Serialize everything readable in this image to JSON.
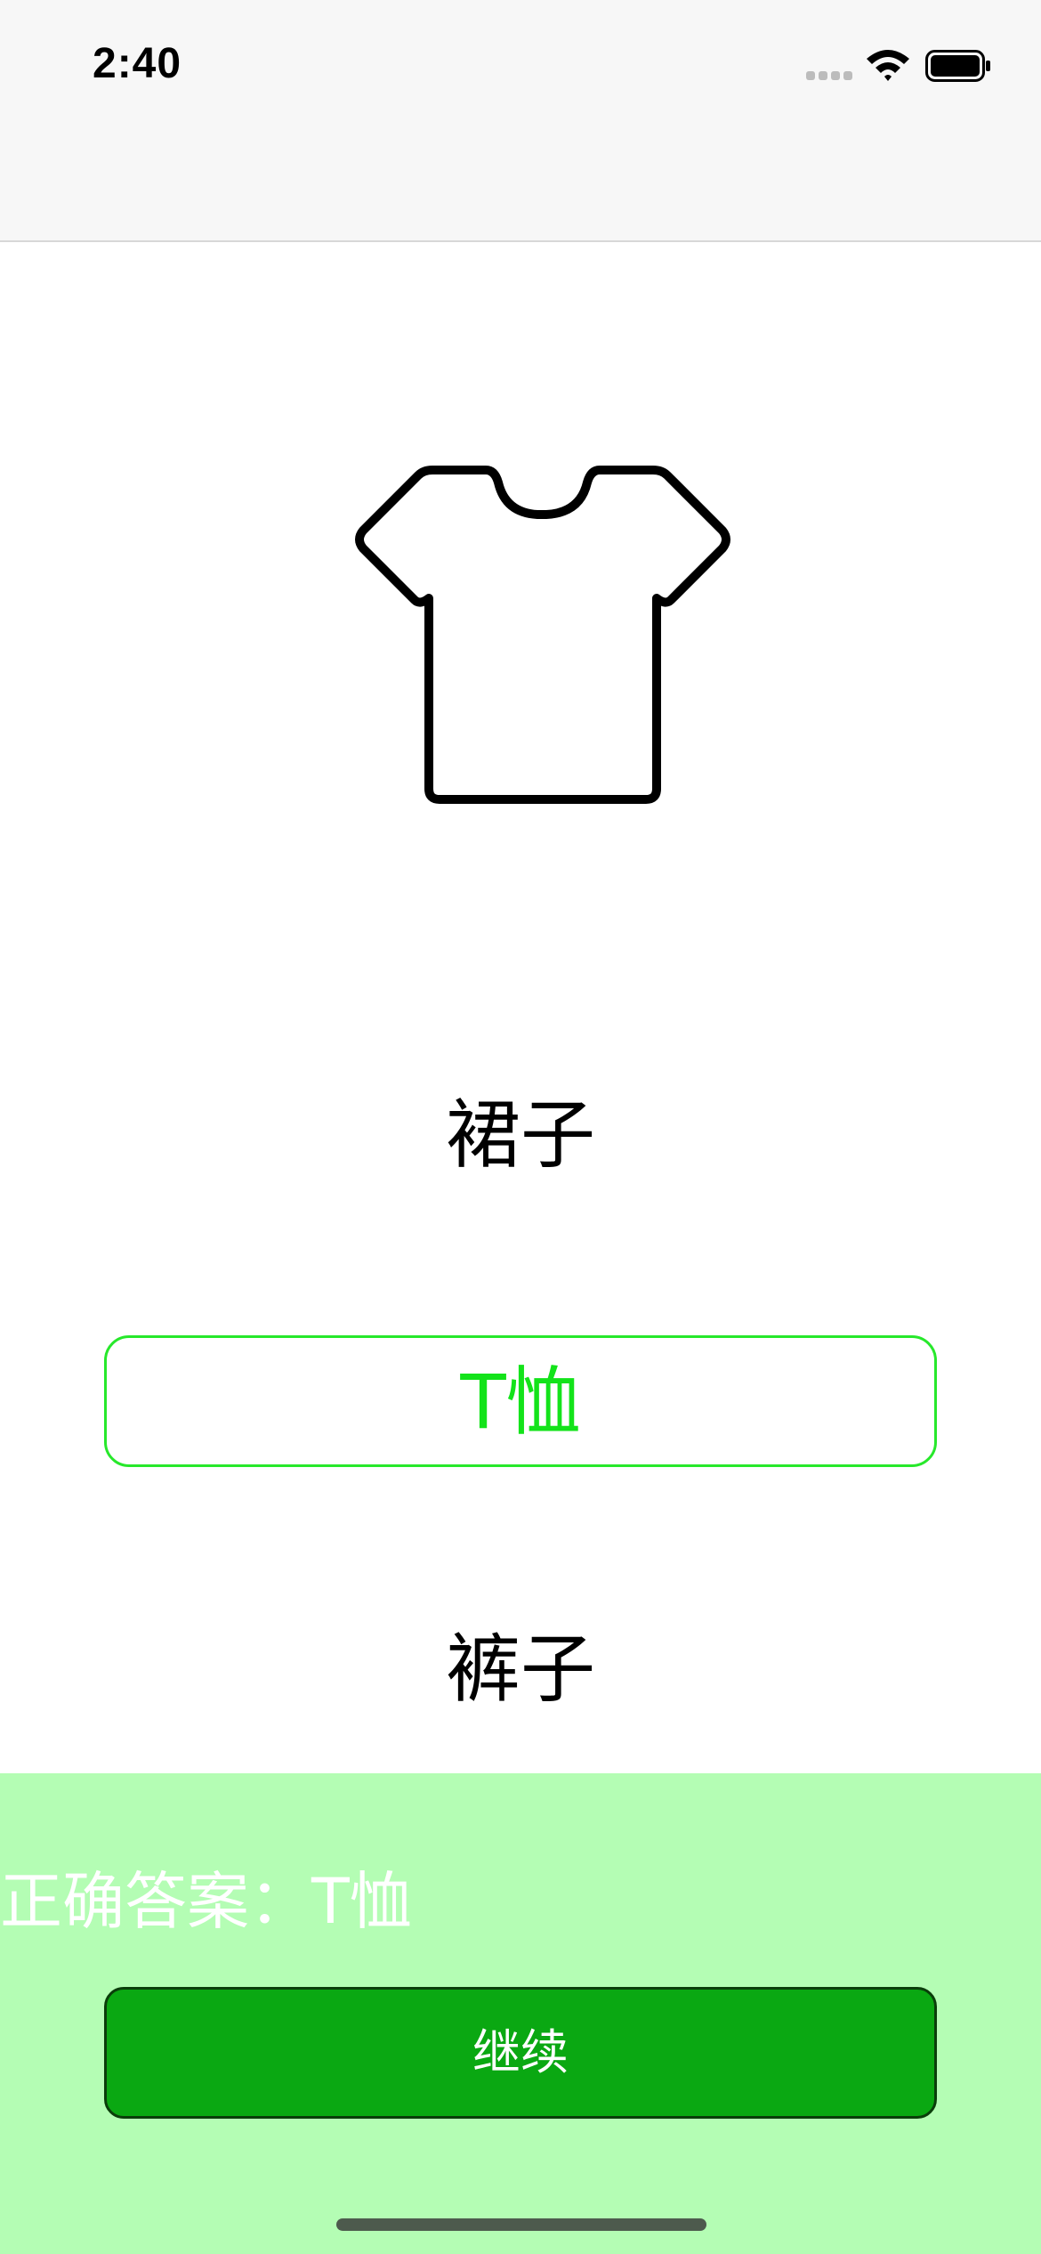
{
  "status_bar": {
    "time": "2:40"
  },
  "illustration": {
    "icon": "t-shirt-icon"
  },
  "options": [
    {
      "label": "裙子",
      "state": "default"
    },
    {
      "label": "T恤",
      "state": "correct"
    },
    {
      "label": "裤子",
      "state": "default"
    }
  ],
  "feedback": {
    "text": "正确答案：T恤",
    "continue_label": "继续"
  },
  "colors": {
    "correct_green": "#13e31a",
    "feedback_bg": "#b4fdb4",
    "button_bg": "#0aa812"
  }
}
